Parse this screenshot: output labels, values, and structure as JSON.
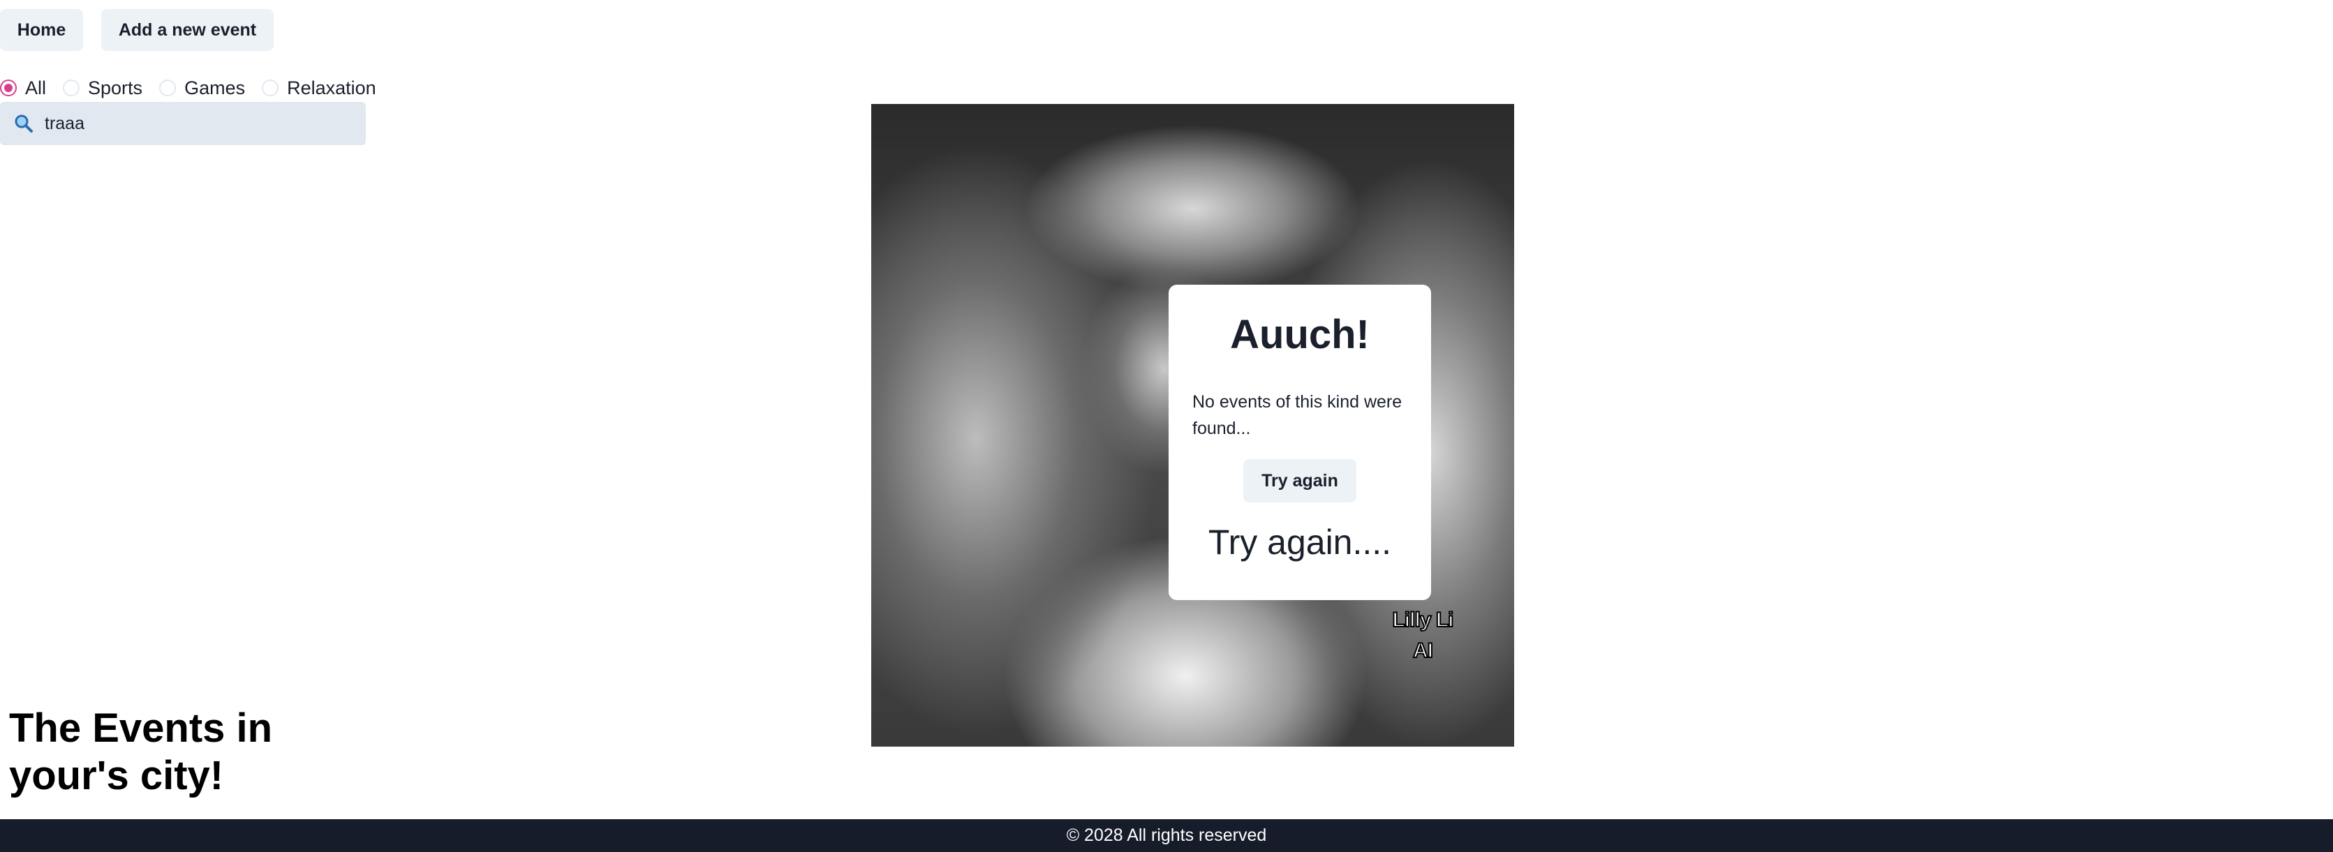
{
  "nav": {
    "home_label": "Home",
    "add_label": "Add a new event"
  },
  "filters": {
    "options": [
      "All",
      "Sports",
      "Games",
      "Relaxation"
    ],
    "selected": "All"
  },
  "search": {
    "value": "traaa",
    "icon": "search-icon"
  },
  "hero": {
    "watermark": "Lilly Li\nAI"
  },
  "empty_card": {
    "title": "Auuch!",
    "message": "No events of this kind were found...",
    "button_label": "Try again",
    "caption": "Try again...."
  },
  "page": {
    "heading": "The Events in your's city!"
  },
  "footer": {
    "text": "© 2028 All rights reserved"
  },
  "colors": {
    "accent": "#d53f8c",
    "button_bg": "#edf2f7",
    "search_bg": "#e2e8f0",
    "footer_bg": "#171c2a"
  }
}
